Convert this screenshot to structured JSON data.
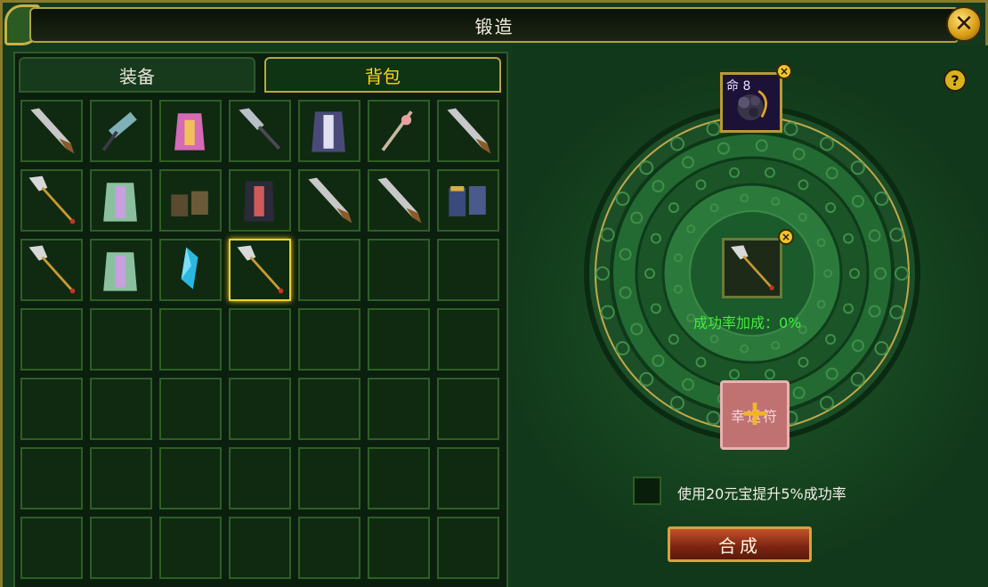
{
  "window": {
    "title": "锻造",
    "close_icon": "close-icon"
  },
  "tabs": [
    {
      "label": "装备",
      "active": false
    },
    {
      "label": "背包",
      "active": true
    }
  ],
  "inventory": {
    "columns": 7,
    "rows": 7,
    "items": [
      "sword-icon",
      "hammer-icon",
      "robe-pink-icon",
      "dagger-icon",
      "armor-robe-icon",
      "rapier-icon",
      "sword-icon",
      "golden-sword-icon",
      "robe-green-icon",
      "boots-icon",
      "armor-dark-icon",
      "sword-icon",
      "sword-icon",
      "boots-blue-icon",
      "golden-sword-icon",
      "robe-green-icon",
      "crystal-icon",
      "golden-sword-icon",
      "",
      "",
      ""
    ],
    "selected_index": 17
  },
  "forge": {
    "help_label": "?",
    "top_slot_label": "命 8",
    "remove_symbol": "×",
    "success_rate_text": "成功率加成：0%",
    "charm_label": "幸运符",
    "charm_plus": "+",
    "checkbox_checked": false,
    "checkbox_label": "使用20元宝提升5%成功率",
    "merge_button_label": "合成"
  },
  "colors": {
    "accent_gold": "#d6a23e",
    "rate_green": "#41ef3a",
    "tab_active_text": "#ffd51a"
  }
}
